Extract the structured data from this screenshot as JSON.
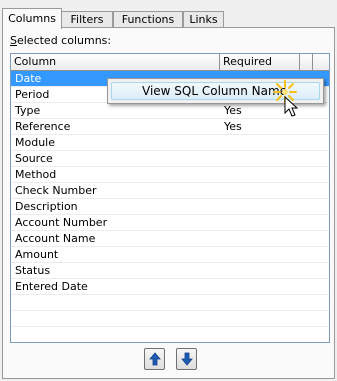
{
  "tabs": [
    {
      "label": "Columns",
      "active": true
    },
    {
      "label": "Filters",
      "active": false
    },
    {
      "label": "Functions",
      "active": false
    },
    {
      "label": "Links",
      "active": false
    }
  ],
  "selected_columns_label_mnemonic": "S",
  "selected_columns_label_rest": "elected columns:",
  "table": {
    "headers": {
      "column": "Column",
      "required": "Required"
    },
    "rows": [
      {
        "column": "Date",
        "required": ""
      },
      {
        "column": "Period",
        "required": ""
      },
      {
        "column": "Type",
        "required": "Yes"
      },
      {
        "column": "Reference",
        "required": "Yes"
      },
      {
        "column": "Module",
        "required": ""
      },
      {
        "column": "Source",
        "required": ""
      },
      {
        "column": "Method",
        "required": ""
      },
      {
        "column": "Check Number",
        "required": ""
      },
      {
        "column": "Description",
        "required": ""
      },
      {
        "column": "Account Number",
        "required": ""
      },
      {
        "column": "Account Name",
        "required": ""
      },
      {
        "column": "Amount",
        "required": ""
      },
      {
        "column": "Status",
        "required": ""
      },
      {
        "column": "Entered Date",
        "required": ""
      }
    ],
    "selected_row": 0
  },
  "context_menu": {
    "item": "View SQL Column Name"
  },
  "buttons": {
    "move_up_icon": "arrow-up-icon",
    "move_down_icon": "arrow-down-icon"
  },
  "colors": {
    "selection": "#3399ff",
    "menu_hover": "#dcecf8",
    "arrow": "#1e5cb3"
  }
}
